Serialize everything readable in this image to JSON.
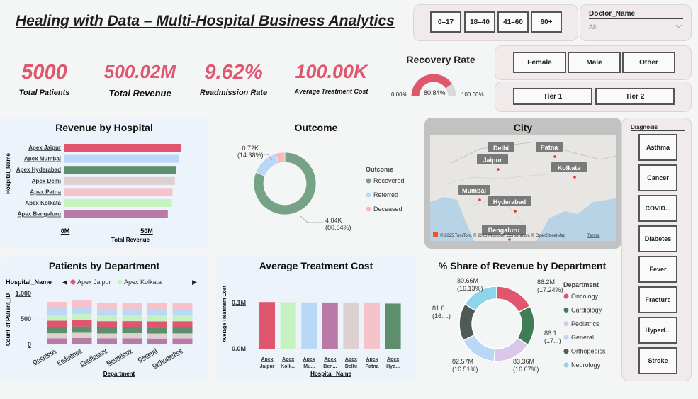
{
  "header": {
    "title": "Healing with Data – Multi-Hospital Business Analytics"
  },
  "kpis": [
    {
      "value": "5000",
      "label": "Total Patients"
    },
    {
      "value": "500.02M",
      "label": "Total Revenue"
    },
    {
      "value": "9.62%",
      "label": "Readmission Rate"
    },
    {
      "value": "100.00K",
      "label": "Average Treatment Cost"
    }
  ],
  "age_slicer": {
    "options": [
      "0–17",
      "18–40",
      "41–60",
      "60+"
    ]
  },
  "doctor_slicer": {
    "label": "Doctor_Name",
    "value": "All"
  },
  "gender_slicer": {
    "options": [
      "Female",
      "Male",
      "Other"
    ]
  },
  "tier_slicer": {
    "options": [
      "Tier 1",
      "Tier 2"
    ]
  },
  "recovery_gauge": {
    "title": "Recovery Rate",
    "value_label": "80.84%",
    "min_label": "0.00%",
    "max_label": "100.00%",
    "value": 0.8084,
    "fill_color": "#e0566e",
    "track_color": "#d9d9d9"
  },
  "revenue_by_hospital": {
    "title": "Revenue by Hospital",
    "ylabel": "Hospital_Name",
    "xlabel": "Total Revenue",
    "ticks": [
      "0M",
      "50M"
    ],
    "chart_data": {
      "type": "bar",
      "orientation": "horizontal",
      "categories": [
        "Apex Jaipur",
        "Apex Mumbai",
        "Apex Hyderabad",
        "Apex Delhi",
        "Apex Patna",
        "Apex Kolkata",
        "Apex Bengaluru"
      ],
      "values": [
        74.5,
        73.0,
        71.0,
        70.5,
        69.0,
        68.5,
        66.0
      ],
      "colors": [
        "#e0566e",
        "#b9d8f7",
        "#5e8f6d",
        "#ddd0d0",
        "#f6c3cb",
        "#c6f2c1",
        "#b97aa8"
      ],
      "xlim": [
        0,
        80
      ],
      "unit": "M"
    }
  },
  "outcome": {
    "title": "Outcome",
    "legend_title": "Outcome",
    "labels": [
      {
        "value": "0.72K",
        "pct": "(14.38%)"
      },
      {
        "value": "4.04K",
        "pct": "(80.84%)"
      }
    ],
    "chart_data": {
      "type": "pie",
      "donut": true,
      "categories": [
        "Recovered",
        "Referred",
        "Deceased"
      ],
      "values": [
        4040,
        719,
        241
      ],
      "colors": [
        "#76a386",
        "#b9d8f7",
        "#f6b6c2"
      ]
    }
  },
  "city_map": {
    "title": "City",
    "cities": [
      "Delhi",
      "Patna",
      "Jaipur",
      "Kolkata",
      "Mumbai",
      "Hyderabad",
      "Bengaluru"
    ],
    "attribution": "© 2025 TomTom, © 2026 Microsoft Corporation, © OpenStreetMap",
    "terms": "Terms"
  },
  "diagnosis": {
    "label": "Diagnosis",
    "options": [
      "Asthma",
      "Cancer",
      "COVID...",
      "Diabetes",
      "Fever",
      "Fracture",
      "Hypert...",
      "Stroke"
    ]
  },
  "patients_by_department": {
    "title": "Patients by Department",
    "legend_title": "Hospital_Name",
    "legend_visible": [
      {
        "name": "Apex Jaipur",
        "color": "#e0566e"
      },
      {
        "name": "Apex Kolkata",
        "color": "#c6f2c1"
      }
    ],
    "ylabel": "Count of Patient_ID",
    "xlabel": "Department",
    "yticks": [
      "1,000",
      "500",
      "0"
    ],
    "chart_data": {
      "type": "bar",
      "stacked": true,
      "categories": [
        "Oncology",
        "Pediatrics",
        "Cardiology",
        "Neurology",
        "General",
        "Orthopedics"
      ],
      "ylim": [
        0,
        1000
      ],
      "series": [
        {
          "name": "Apex Bengaluru",
          "color": "#b97aa8",
          "values": [
            120,
            125,
            118,
            120,
            115,
            117
          ]
        },
        {
          "name": "Apex Delhi",
          "color": "#ddd0d0",
          "values": [
            100,
            105,
            98,
            102,
            100,
            100
          ]
        },
        {
          "name": "Apex Hyderabad",
          "color": "#5e8f6d",
          "values": [
            120,
            122,
            118,
            115,
            117,
            116
          ]
        },
        {
          "name": "Apex Jaipur",
          "color": "#e0566e",
          "values": [
            125,
            130,
            122,
            120,
            121,
            122
          ]
        },
        {
          "name": "Apex Kolkata",
          "color": "#c6f2c1",
          "values": [
            118,
            120,
            115,
            116,
            116,
            115
          ]
        },
        {
          "name": "Apex Mumbai",
          "color": "#b9d8f7",
          "values": [
            122,
            125,
            120,
            118,
            118,
            118
          ]
        },
        {
          "name": "Apex Patna",
          "color": "#f6c3cb",
          "values": [
            130,
            135,
            127,
            123,
            123,
            117
          ]
        }
      ]
    }
  },
  "avg_treatment_cost": {
    "title": "Average Treatment Cost",
    "ylabel": "Average Treatment Cost",
    "xlabel": "Hospital_Name",
    "yticks": [
      "0.1M",
      "0.0M"
    ],
    "x_labels": [
      [
        "Apex",
        "Jaipur"
      ],
      [
        "Apex",
        "Kolk..."
      ],
      [
        "Apex",
        "Mu..."
      ],
      [
        "Apex",
        "Ben..."
      ],
      [
        "Apex",
        "Delhi"
      ],
      [
        "Apex",
        "Patna"
      ],
      [
        "Apex",
        "Hyd..."
      ]
    ],
    "chart_data": {
      "type": "bar",
      "categories": [
        "Apex Jaipur",
        "Apex Kolkata",
        "Apex Mumbai",
        "Apex Bengaluru",
        "Apex Delhi",
        "Apex Patna",
        "Apex Hyderabad"
      ],
      "values": [
        0.1012,
        0.1008,
        0.1002,
        0.1001,
        0.0998,
        0.0995,
        0.0978
      ],
      "colors": [
        "#e0566e",
        "#c6f2c1",
        "#b9d8f7",
        "#b97aa8",
        "#ddd0d0",
        "#f6c3cb",
        "#5e8f6d"
      ],
      "ylim": [
        0,
        0.1
      ],
      "unit": "M"
    }
  },
  "revenue_by_department": {
    "title": "% Share of Revenue by Department",
    "legend_title": "Department",
    "slice_labels": [
      {
        "value": "86.2M",
        "pct": "(17.24%)"
      },
      {
        "value": "86.1...",
        "pct": "(17...)"
      },
      {
        "value": "83.36M",
        "pct": "(16.67%)"
      },
      {
        "value": "82.57M",
        "pct": "(16.51%)"
      },
      {
        "value": "81.0...",
        "pct": "(16....)"
      },
      {
        "value": "80.66M",
        "pct": "(16.13%)"
      }
    ],
    "chart_data": {
      "type": "pie",
      "donut": true,
      "categories": [
        "Oncology",
        "Cardiology",
        "Pediatrics",
        "General",
        "Orthopedics",
        "Neurology"
      ],
      "values": [
        86.2,
        86.1,
        83.36,
        82.57,
        81.0,
        80.66
      ],
      "colors": [
        "#e0566e",
        "#3e7d55",
        "#d9c7ec",
        "#b9d8f7",
        "#4f5a58",
        "#8ed5ea"
      ]
    }
  }
}
